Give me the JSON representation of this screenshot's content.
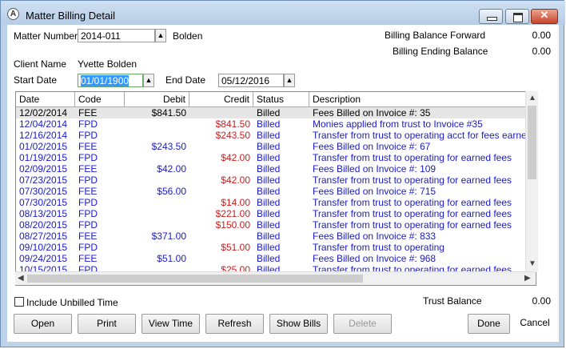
{
  "window": {
    "title": "Matter Billing Detail"
  },
  "header": {
    "matter_number_label": "Matter Number",
    "matter_number_value": "2014-011",
    "matter_name": "Bolden",
    "billing_balance_label": "Billing Balance  Forward",
    "billing_balance_value": "0.00",
    "billing_ending_label": "Billing Ending Balance",
    "billing_ending_value": "0.00",
    "client_name_label": "Client Name",
    "client_name_value": "Yvette Bolden",
    "start_date_label": "Start Date",
    "start_date_value": "01/01/1900",
    "end_date_label": "End Date",
    "end_date_value": "05/12/2016"
  },
  "grid": {
    "columns": [
      "Date",
      "Code",
      "Debit",
      "Credit",
      "Status",
      "Description"
    ],
    "rows": [
      {
        "date": "12/02/2014",
        "code": "FEE",
        "debit": "$841.50",
        "credit": "",
        "status": "Billed",
        "description": "Fees Billed on Invoice #: 35",
        "selected": true
      },
      {
        "date": "12/04/2014",
        "code": "FPD",
        "debit": "",
        "credit": "$841.50",
        "status": "Billed",
        "description": "Monies applied from trust to Invoice #35"
      },
      {
        "date": "12/16/2014",
        "code": "FPD",
        "debit": "",
        "credit": "$243.50",
        "status": "Billed",
        "description": "Transfer from trust to operating acct for fees earned"
      },
      {
        "date": "01/02/2015",
        "code": "FEE",
        "debit": "$243.50",
        "credit": "",
        "status": "Billed",
        "description": "Fees Billed on Invoice #: 67"
      },
      {
        "date": "01/19/2015",
        "code": "FPD",
        "debit": "",
        "credit": "$42.00",
        "status": "Billed",
        "description": "Transfer from trust to operating for earned fees"
      },
      {
        "date": "02/09/2015",
        "code": "FEE",
        "debit": "$42.00",
        "credit": "",
        "status": "Billed",
        "description": "Fees Billed on Invoice #: 109"
      },
      {
        "date": "07/23/2015",
        "code": "FPD",
        "debit": "",
        "credit": "$42.00",
        "status": "Billed",
        "description": "Transfer from trust to operating for earned fees"
      },
      {
        "date": "07/30/2015",
        "code": "FEE",
        "debit": "$56.00",
        "credit": "",
        "status": "Billed",
        "description": "Fees Billed on Invoice #: 715"
      },
      {
        "date": "07/30/2015",
        "code": "FPD",
        "debit": "",
        "credit": "$14.00",
        "status": "Billed",
        "description": "Transfer from trust to operating for earned fees"
      },
      {
        "date": "08/13/2015",
        "code": "FPD",
        "debit": "",
        "credit": "$221.00",
        "status": "Billed",
        "description": "Transfer from trust to operating for earned fees"
      },
      {
        "date": "08/20/2015",
        "code": "FPD",
        "debit": "",
        "credit": "$150.00",
        "status": "Billed",
        "description": "Transfer from trust to operating for earned fees"
      },
      {
        "date": "08/27/2015",
        "code": "FEE",
        "debit": "$371.00",
        "credit": "",
        "status": "Billed",
        "description": "Fees Billed on Invoice #: 833"
      },
      {
        "date": "09/10/2015",
        "code": "FPD",
        "debit": "",
        "credit": "$51.00",
        "status": "Billed",
        "description": "Transfer from trust to operating"
      },
      {
        "date": "09/24/2015",
        "code": "FEE",
        "debit": "$51.00",
        "credit": "",
        "status": "Billed",
        "description": "Fees Billed on Invoice #: 968"
      },
      {
        "date": "10/15/2015",
        "code": "FPD",
        "debit": "",
        "credit": "$25.00",
        "status": "Billed",
        "description": "Transfer from trust to operating for earned fees"
      }
    ]
  },
  "footer": {
    "include_unbilled_label": "Include Unbilled Time",
    "trust_balance_label": "Trust Balance",
    "trust_balance_value": "0.00"
  },
  "buttons": {
    "open": "Open",
    "print": "Print",
    "view_time": "View Time",
    "refresh": "Refresh",
    "show_bills": "Show Bills",
    "delete": "Delete",
    "done": "Done",
    "cancel": "Cancel"
  },
  "colors": {
    "blue_text": "#1a1acc",
    "red_text": "#d11a1a",
    "selected_row": "#e6e6e6"
  }
}
